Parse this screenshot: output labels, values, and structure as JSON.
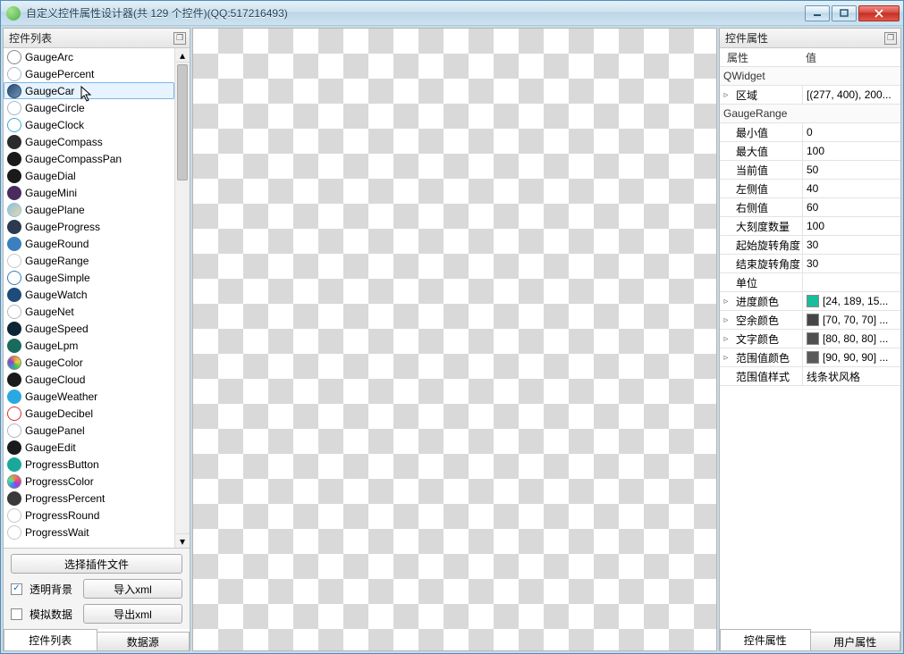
{
  "window": {
    "title": "自定义控件属性设计器(共 129 个控件)(QQ:517216493)"
  },
  "left": {
    "title": "控件列表",
    "items": [
      {
        "label": "GaugeArc",
        "icon": "#ffffff",
        "ring": "#888"
      },
      {
        "label": "GaugePercent",
        "icon": "#ffffff",
        "ring": "#a8b8c8"
      },
      {
        "label": "GaugeCar",
        "icon": "linear-gradient(135deg,#2b4a6e,#6e95b8)",
        "ring": "#2b4a6e",
        "selected": true
      },
      {
        "label": "GaugeCircle",
        "icon": "#ffffff",
        "ring": "#a8b8c8"
      },
      {
        "label": "GaugeClock",
        "icon": "#ffffff",
        "ring": "#4aa8d4"
      },
      {
        "label": "GaugeCompass",
        "icon": "#2b2b2b",
        "ring": "#2b2b2b"
      },
      {
        "label": "GaugeCompassPan",
        "icon": "#1a1a1a",
        "ring": "#1a1a1a"
      },
      {
        "label": "GaugeDial",
        "icon": "#1a1a1a",
        "ring": "#1a1a1a"
      },
      {
        "label": "GaugeMini",
        "icon": "#4a2b5e",
        "ring": "#4a2b5e"
      },
      {
        "label": "GaugePlane",
        "icon": "linear-gradient(135deg,#8cc0e0,#e8d8a8)",
        "ring": "#8cc0e0"
      },
      {
        "label": "GaugeProgress",
        "icon": "#2b3a4e",
        "ring": "#2b3a4e"
      },
      {
        "label": "GaugeRound",
        "icon": "#3a7fbf",
        "ring": "#3a7fbf"
      },
      {
        "label": "GaugeRange",
        "icon": "#ffffff",
        "ring": "#c8c8c8"
      },
      {
        "label": "GaugeSimple",
        "icon": "#ffffff",
        "ring": "#3a7fbf"
      },
      {
        "label": "GaugeWatch",
        "icon": "#1e4b7a",
        "ring": "#1e4b7a"
      },
      {
        "label": "GaugeNet",
        "icon": "#ffffff",
        "ring": "#b8b8b8"
      },
      {
        "label": "GaugeSpeed",
        "icon": "#0d2436",
        "ring": "#0d2436"
      },
      {
        "label": "GaugeLpm",
        "icon": "#1a6b5e",
        "ring": "#1a6b5e"
      },
      {
        "label": "GaugeColor",
        "icon": "conic-gradient(#e84,#ec4,#4c4,#48c,#84c,#e84)",
        "ring": "#888"
      },
      {
        "label": "GaugeCloud",
        "icon": "#1a1a1a",
        "ring": "#1a1a1a"
      },
      {
        "label": "GaugeWeather",
        "icon": "#2aa8e0",
        "ring": "#2aa8e0"
      },
      {
        "label": "GaugeDecibel",
        "icon": "#ffffff",
        "ring": "#e03030"
      },
      {
        "label": "GaugePanel",
        "icon": "#ffffff",
        "ring": "#a8b8c8"
      },
      {
        "label": "GaugeEdit",
        "icon": "#1a1a1a",
        "ring": "#1a1a1a"
      },
      {
        "label": "ProgressButton",
        "icon": "#1aa89c",
        "ring": "#1aa89c"
      },
      {
        "label": "ProgressColor",
        "icon": "conic-gradient(#e84,#e48,#84e,#48e,#4e8,#e84)",
        "ring": "#888"
      },
      {
        "label": "ProgressPercent",
        "icon": "#3a3a3a",
        "ring": "#3a3a3a"
      },
      {
        "label": "ProgressRound",
        "icon": "#ffffff",
        "ring": "#c8c8c8"
      },
      {
        "label": "ProgressWait",
        "icon": "#ffffff",
        "ring": "#c8c8c8"
      }
    ],
    "buttons": {
      "selectPlugin": "选择插件文件",
      "importXml": "导入xml",
      "exportXml": "导出xml"
    },
    "checkboxes": {
      "transparentBg": "透明背景",
      "mockData": "模拟数据"
    },
    "tabs": {
      "widgetList": "控件列表",
      "dataSource": "数据源"
    }
  },
  "right": {
    "title": "控件属性",
    "headers": {
      "name": "属性",
      "value": "值"
    },
    "groupQWidget": "QWidget",
    "rowRegion": {
      "name": "区域",
      "value": "[(277, 400), 200..."
    },
    "groupGaugeRange": "GaugeRange",
    "rows": [
      {
        "name": "最小值",
        "value": "0"
      },
      {
        "name": "最大值",
        "value": "100"
      },
      {
        "name": "当前值",
        "value": "50"
      },
      {
        "name": "左侧值",
        "value": "40"
      },
      {
        "name": "右侧值",
        "value": "60"
      },
      {
        "name": "大刻度数量",
        "value": "100"
      },
      {
        "name": "起始旋转角度",
        "value": "30"
      },
      {
        "name": "结束旋转角度",
        "value": "30"
      },
      {
        "name": "单位",
        "value": ""
      }
    ],
    "colorRows": [
      {
        "name": "进度颜色",
        "value": "[24, 189, 15...",
        "swatch": "#18bd9b"
      },
      {
        "name": "空余颜色",
        "value": "[70, 70, 70] ...",
        "swatch": "#464646"
      },
      {
        "name": "文字颜色",
        "value": "[80, 80, 80] ...",
        "swatch": "#505050"
      },
      {
        "name": "范围值颜色",
        "value": "[90, 90, 90] ...",
        "swatch": "#5a5a5a"
      }
    ],
    "styleRow": {
      "name": "范围值样式",
      "value": "线条状风格"
    },
    "tabs": {
      "widgetProps": "控件属性",
      "userProps": "用户属性"
    }
  }
}
